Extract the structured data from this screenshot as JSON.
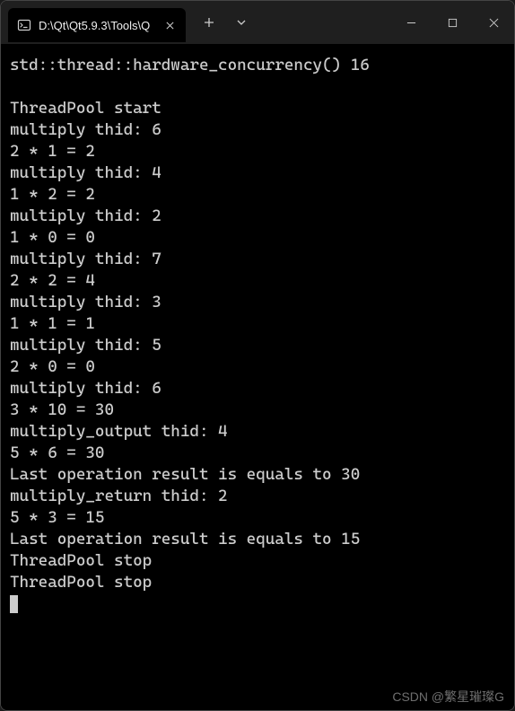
{
  "titlebar": {
    "tab_title": "D:\\Qt\\Qt5.9.3\\Tools\\Q",
    "icons": {
      "tab": "terminal-icon",
      "close_tab": "close-icon",
      "new_tab": "plus-icon",
      "dropdown": "chevron-down-icon",
      "minimize": "minimize-icon",
      "maximize": "maximize-icon",
      "close_window": "close-icon"
    }
  },
  "terminal": {
    "lines": [
      "std::thread::hardware_concurrency() 16",
      "",
      "ThreadPool start",
      "multiply thid: 6",
      "2 * 1 = 2",
      "multiply thid: 4",
      "1 * 2 = 2",
      "multiply thid: 2",
      "1 * 0 = 0",
      "multiply thid: 7",
      "2 * 2 = 4",
      "multiply thid: 3",
      "1 * 1 = 1",
      "multiply thid: 5",
      "2 * 0 = 0",
      "multiply thid: 6",
      "3 * 10 = 30",
      "multiply_output thid: 4",
      "5 * 6 = 30",
      "Last operation result is equals to 30",
      "multiply_return thid: 2",
      "5 * 3 = 15",
      "Last operation result is equals to 15",
      "ThreadPool stop",
      "ThreadPool stop"
    ]
  },
  "watermark": "CSDN @繁星璀璨G"
}
